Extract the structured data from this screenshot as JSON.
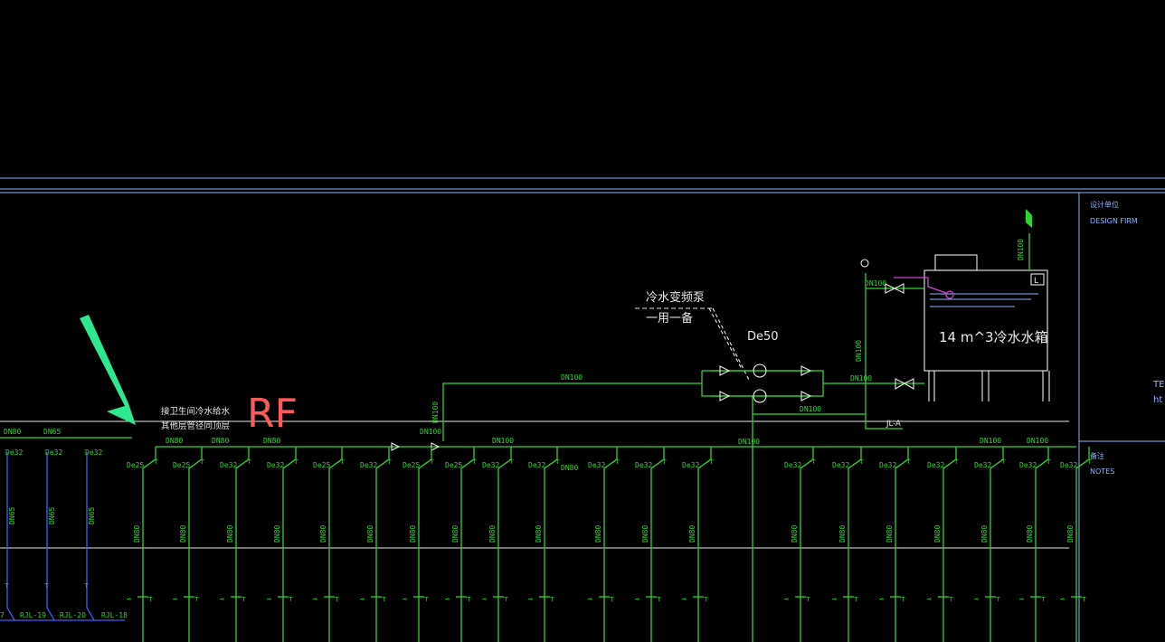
{
  "colors": {
    "background": "#000000",
    "pipe": "#2fd52f",
    "frame": "#8fb4ff",
    "riser_blue": "#3a5cff",
    "annotation_red": "#ff5a5a",
    "arrow": "#2ee890",
    "magenta": "#d040d0"
  },
  "title_block": {
    "design_firm_cn": "设计单位",
    "design_firm_en": "DESIGN FIRM",
    "notes_cn": "备注",
    "notes_en": "NOTES",
    "edge_te": "TE",
    "edge_ht": "ht"
  },
  "floor_label": "RF",
  "notes": {
    "connect_line1": "接卫生间冷水给水",
    "connect_line2": "其他层管径同顶层"
  },
  "pump": {
    "label_line1": "冷水变频泵",
    "label_line2": "一用一备",
    "pipe_size": "De50"
  },
  "tank": {
    "label": "14 m^3冷水水箱",
    "level_mark": "L"
  },
  "labels": {
    "dn100": "DN100",
    "dn80": "DN80",
    "dn65": "DN65",
    "riser": "JL-A"
  },
  "left_risers": {
    "top_sizes": [
      "DN80",
      "DN65"
    ],
    "branch_sizes": [
      "De32",
      "De32",
      "De32"
    ],
    "tags": [
      "7",
      "RJL-19",
      "RJL-20",
      "RJL-18"
    ]
  },
  "main": {
    "segment_labels": [
      "DN80",
      "DN80",
      "DN80",
      "DN100",
      "DN100",
      "DN100",
      "DN80"
    ],
    "branch_sizes": [
      "De25",
      "De25",
      "De32",
      "De32",
      "De25",
      "De32",
      "De25",
      "De25",
      "De32",
      "De32",
      "De32",
      "De32",
      "De32",
      "De32",
      "De32",
      "De32",
      "De32",
      "De32",
      "De32",
      "De32",
      "De32"
    ],
    "riser_sizes": [
      "DN80",
      "DN80",
      "DN80",
      "DN80",
      "DN80",
      "DN80",
      "DN80",
      "DN80",
      "DN80",
      "DN80",
      "DN80",
      "DN80",
      "DN80",
      "DN80",
      "DN80",
      "DN80",
      "DN80",
      "DN80",
      "DN80",
      "DN80",
      "DN80"
    ]
  }
}
